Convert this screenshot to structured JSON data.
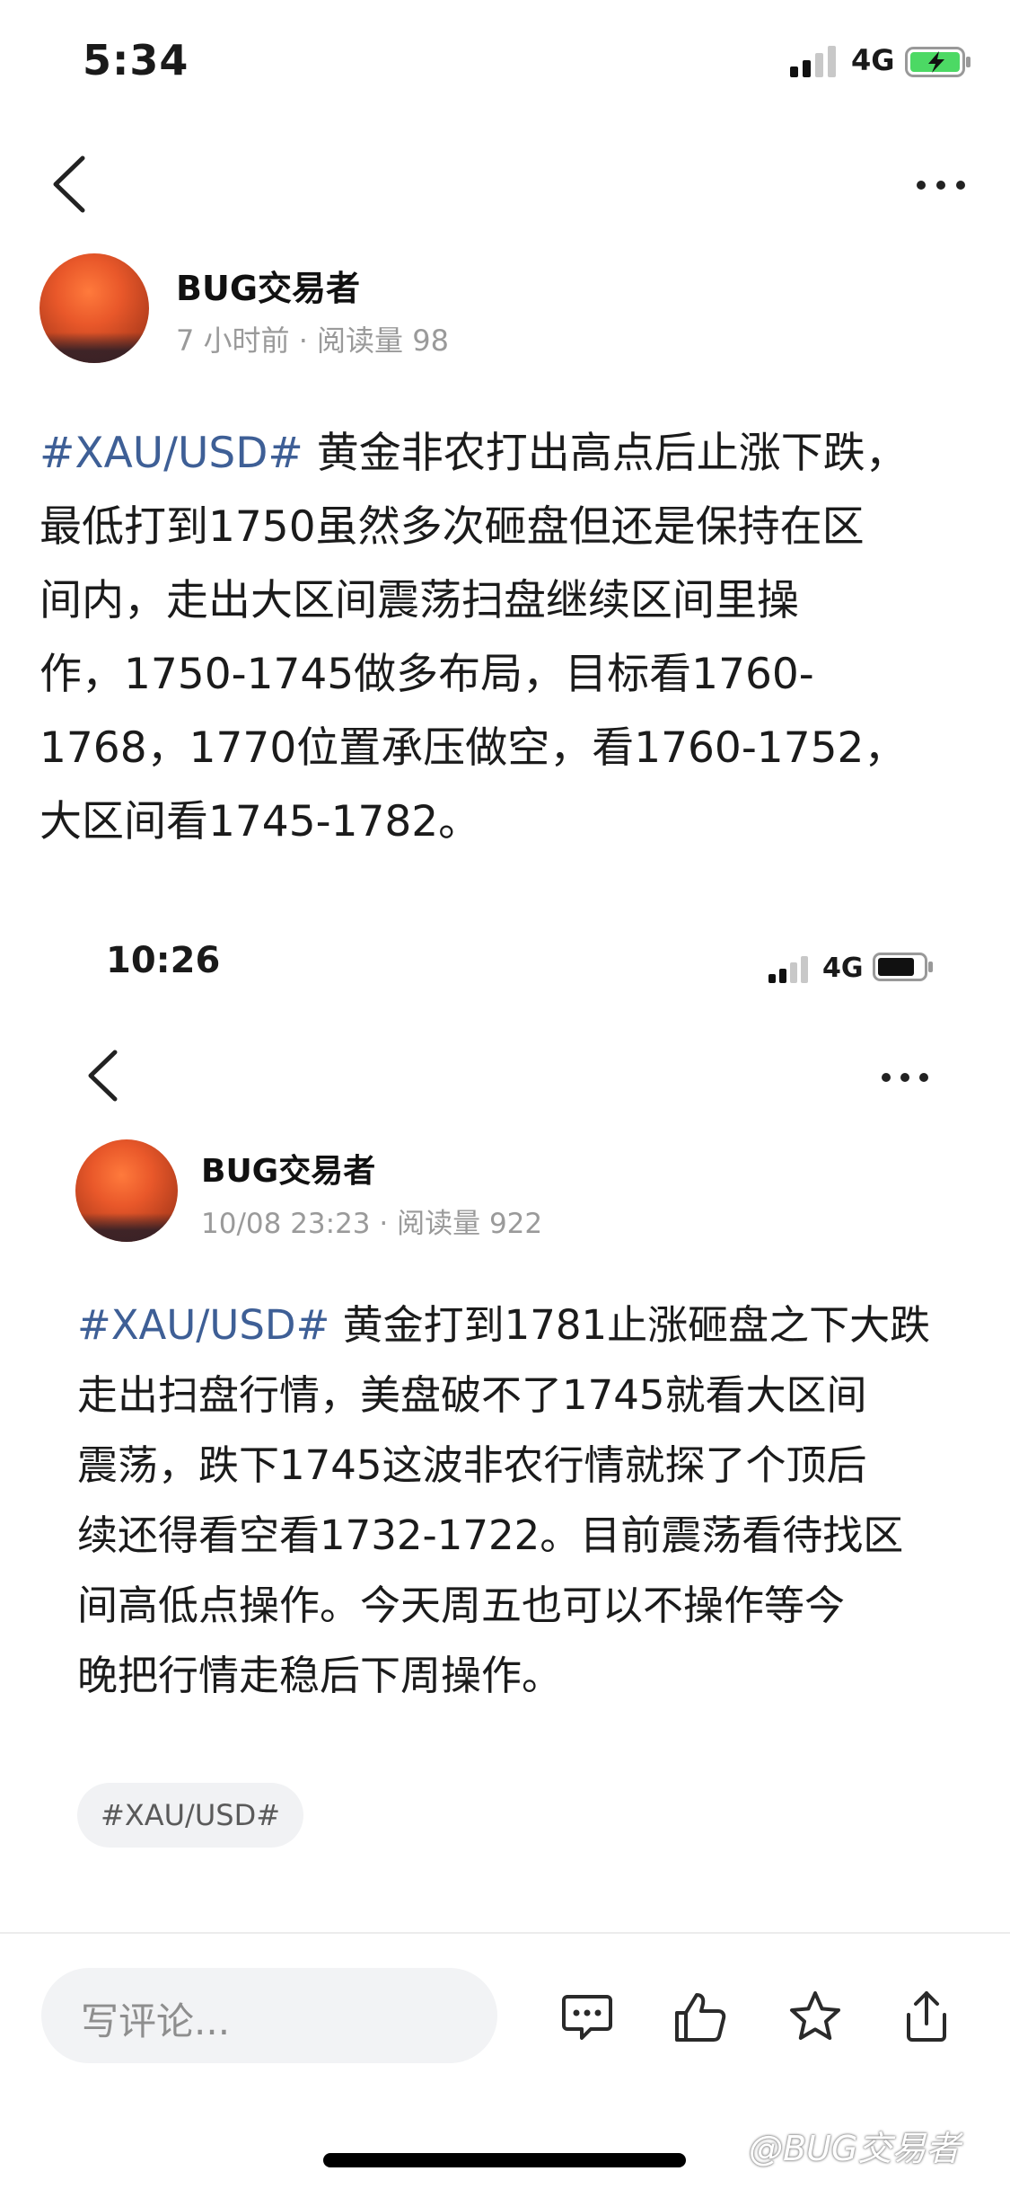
{
  "status_bar": {
    "time": "5:34",
    "network": "4G"
  },
  "post1": {
    "author": "BUG交易者",
    "meta": "7 小时前 · 阅读量 98",
    "lines": [
      {
        "tag": "#XAU/USD#",
        "text": " 黄金非农打出高点后止涨下跌，"
      },
      {
        "text": "最低打到1750虽然多次砸盘但还是保持在区"
      },
      {
        "text": "间内，走出大区间震荡扫盘继续区间里操"
      },
      {
        "text": "作，1750-1745做多布局，目标看1760-"
      },
      {
        "text": "1768，1770位置承压做空，看1760-1752，"
      },
      {
        "text": "大区间看1745-1782。"
      }
    ]
  },
  "inner_status_bar": {
    "time": "10:26",
    "network": "4G"
  },
  "post2": {
    "author": "BUG交易者",
    "meta": "10/08 23:23 · 阅读量 922",
    "lines": [
      {
        "tag": "#XAU/USD#",
        "text": " 黄金打到1781止涨砸盘之下大跌"
      },
      {
        "text": "走出扫盘行情，美盘破不了1745就看大区间"
      },
      {
        "text": "震荡，跌下1745这波非农行情就探了个顶后"
      },
      {
        "text": "续还得看空看1732-1722。目前震荡看待找区"
      },
      {
        "text": "间高低点操作。今天周五也可以不操作等今"
      },
      {
        "text": "晚把行情走稳后下周操作。"
      }
    ],
    "tag_chip": "#XAU/USD#"
  },
  "bottom_bar": {
    "comment_placeholder": "写评论...",
    "icons": [
      "comment-icon",
      "like-icon",
      "favorite-star-icon",
      "share-icon"
    ]
  },
  "watermark": "@BUG交易者",
  "colors": {
    "tag": "#3e5f96",
    "meta": "#9a9a9a",
    "battery_green": "#4cd964"
  }
}
